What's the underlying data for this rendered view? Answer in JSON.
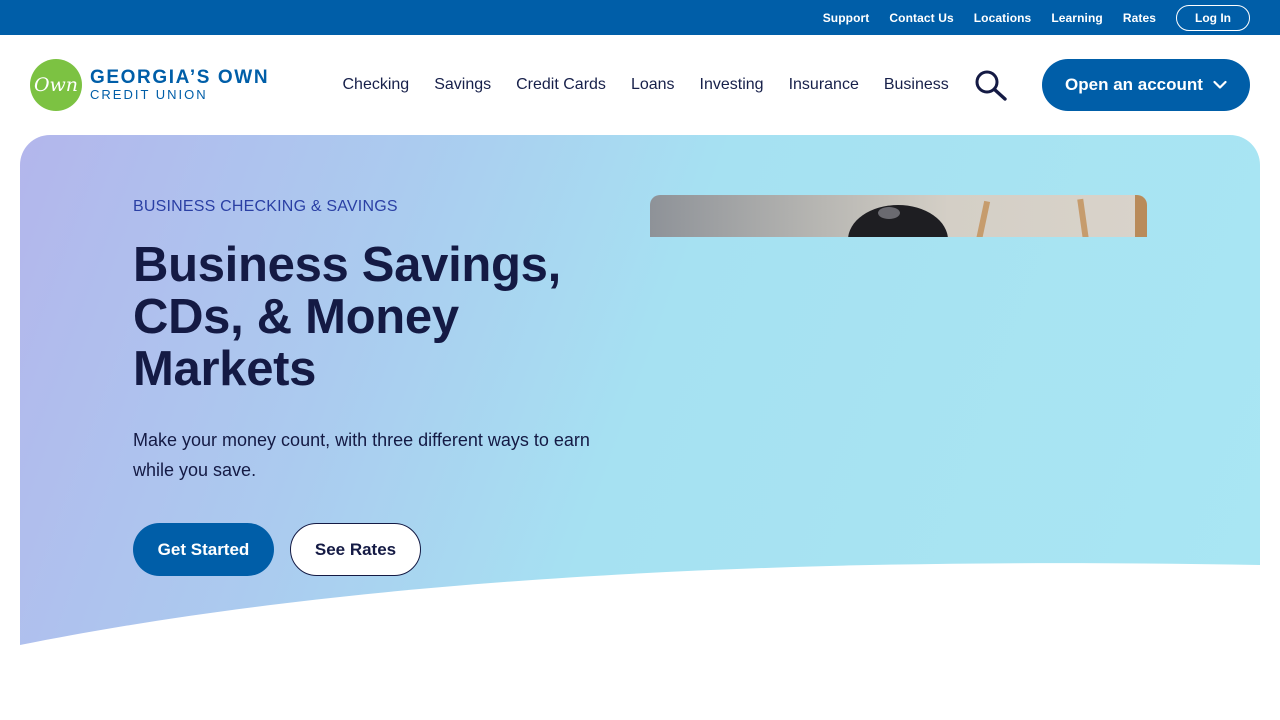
{
  "utility_nav": {
    "links": [
      "Support",
      "Contact Us",
      "Locations",
      "Learning",
      "Rates"
    ],
    "login_label": "Log In"
  },
  "logo": {
    "mark": "Own",
    "name": "GEORGIA’S OWN",
    "sub": "CREDIT UNION"
  },
  "main_nav": {
    "items": [
      "Checking",
      "Savings",
      "Credit Cards",
      "Loans",
      "Investing",
      "Insurance",
      "Business"
    ]
  },
  "search": {
    "icon": "search-icon"
  },
  "open_account": {
    "label": "Open an account",
    "icon": "chevron-down-icon"
  },
  "hero": {
    "eyebrow": "BUSINESS CHECKING & SAVINGS",
    "title": "Business Savings, CDs, & Money Markets",
    "subtitle": "Make your money count, with three different ways to earn while you save.",
    "primary_cta": "Get Started",
    "secondary_cta": "See Rates"
  },
  "colors": {
    "brand_blue": "#005ea8",
    "brand_green": "#7cc242",
    "navy_text": "#141a44",
    "eyebrow_blue": "#2a3fa4"
  }
}
